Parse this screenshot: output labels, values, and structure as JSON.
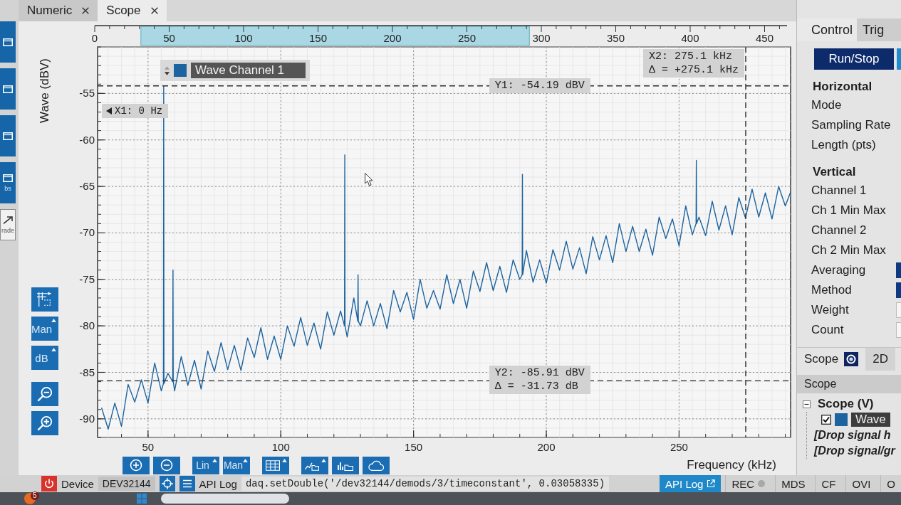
{
  "tabs": [
    {
      "label": "Numeric",
      "selected": false
    },
    {
      "label": "Scope",
      "selected": true
    }
  ],
  "side_strip": [
    {
      "kind": "tile"
    },
    {
      "kind": "tile"
    },
    {
      "kind": "tile"
    },
    {
      "kind": "tile",
      "label": "bs"
    },
    {
      "kind": "outlined",
      "label": "rade"
    }
  ],
  "scope": {
    "y_toolbar": {
      "range_mode": "Man",
      "scale": "dB"
    },
    "overview": {
      "tick_labels": [
        "0",
        "50",
        "100",
        "150",
        "200",
        "250",
        "300",
        "350",
        "400",
        "450"
      ]
    },
    "offscreen_cursor": {
      "label": "X1: 0 Hz"
    },
    "cursor_deltas": {
      "x": "Δ = +275.1 kHz",
      "y": "Δ = -31.73 dB"
    },
    "chart_data": {
      "type": "line",
      "xlabel": "Frequency (kHz)",
      "ylabel": "Wave (dBV)",
      "grid": true,
      "xlim": [
        31,
        292
      ],
      "ylim": [
        -92,
        -50
      ],
      "xticks": [
        50,
        100,
        150,
        200,
        250
      ],
      "yticks": [
        -90,
        -85,
        -80,
        -75,
        -70,
        -65,
        -60,
        -55
      ],
      "x": [
        32.5,
        35,
        37.5,
        40,
        42.5,
        45,
        47.5,
        50,
        52.5,
        55,
        55.8,
        55.9,
        56,
        57.5,
        59.3,
        59.4,
        59.5,
        60,
        62.5,
        65,
        67.5,
        70,
        72.5,
        75,
        77.5,
        80,
        82.5,
        85,
        87.5,
        90,
        92.5,
        95,
        97.5,
        100,
        102.5,
        105,
        107.5,
        110,
        112.5,
        115,
        117.5,
        120,
        122.5,
        124,
        124.1,
        124.2,
        125,
        127.5,
        129,
        129.1,
        129.2,
        130,
        132.5,
        135,
        137.5,
        140,
        142.5,
        145,
        147.5,
        150,
        152.5,
        155,
        157.5,
        160,
        162.5,
        165,
        167.5,
        170,
        172.5,
        175,
        177.5,
        180,
        182.5,
        185,
        187.5,
        190,
        190.9,
        191,
        191.1,
        192.5,
        195,
        197.5,
        200,
        202.5,
        205,
        207.5,
        210,
        212.5,
        215,
        217.5,
        220,
        222.5,
        225,
        227.5,
        230,
        232.5,
        235,
        237.5,
        240,
        242.5,
        245,
        247.5,
        250,
        252.5,
        255,
        256.4,
        256.5,
        256.6,
        257.5,
        260,
        262.5,
        265,
        267.5,
        270,
        272.5,
        275,
        277.5,
        280,
        282.5,
        285,
        287.5,
        290,
        292
      ],
      "series": [
        {
          "name": "Wave Channel 1",
          "color": "#1c64a0",
          "values": [
            -88.8,
            -91.1,
            -88.3,
            -90.8,
            -86.3,
            -88.2,
            -85.8,
            -88.3,
            -84.0,
            -87.0,
            -86.2,
            -54.19,
            -86.2,
            -85.1,
            -86.0,
            -74.0,
            -86.0,
            -87.0,
            -83.3,
            -86.4,
            -83.7,
            -86.8,
            -82.7,
            -84.9,
            -81.8,
            -84.7,
            -82.1,
            -84.8,
            -81.3,
            -83.4,
            -80.2,
            -83.6,
            -81.1,
            -83.6,
            -80.0,
            -82.2,
            -79.1,
            -82.1,
            -79.7,
            -82.5,
            -78.5,
            -81.0,
            -78.4,
            -80.0,
            -61.6,
            -80.0,
            -81.2,
            -77.0,
            -79.5,
            -74.5,
            -79.5,
            -80.0,
            -77.3,
            -80.0,
            -77.6,
            -80.3,
            -76.2,
            -78.5,
            -76.4,
            -79.3,
            -75.0,
            -78.1,
            -76.2,
            -78.2,
            -74.5,
            -77.6,
            -75.0,
            -78.1,
            -74.1,
            -76.3,
            -73.2,
            -76.2,
            -73.6,
            -76.4,
            -72.9,
            -75.0,
            -74.5,
            -63.7,
            -74.5,
            -71.9,
            -75.3,
            -72.9,
            -75.4,
            -71.8,
            -74.0,
            -70.9,
            -73.9,
            -71.6,
            -74.4,
            -70.4,
            -72.9,
            -70.3,
            -73.2,
            -69.0,
            -72.0,
            -69.3,
            -72.0,
            -69.6,
            -72.4,
            -68.3,
            -70.6,
            -68.5,
            -71.4,
            -67.1,
            -70.2,
            -69.0,
            -62.2,
            -69.0,
            -68.3,
            -70.3,
            -66.6,
            -69.7,
            -67.1,
            -70.2,
            -66.2,
            -68.4,
            -65.3,
            -68.3,
            -65.7,
            -68.5,
            -65.0,
            -67.1,
            -65.6
          ]
        }
      ],
      "ref_lines": [
        {
          "axis": "x",
          "value": 275.1,
          "label": "X2: 275.1 kHz"
        },
        {
          "axis": "y",
          "value": -54.19,
          "label": "Y1: -54.19 dBV"
        },
        {
          "axis": "y",
          "value": -85.91,
          "label": "Y2: -85.91 dBV"
        }
      ]
    },
    "x_toolbar": {
      "scale": "Lin",
      "range_mode": "Man"
    }
  },
  "control_panel": {
    "tabs": [
      {
        "label": "Control",
        "selected": true
      },
      {
        "label": "Trig",
        "selected": false
      }
    ],
    "run_button": "Run/Stop",
    "sections": [
      {
        "title": "Horizontal",
        "rows": [
          {
            "label": "Mode",
            "kind": "plain"
          },
          {
            "label": "Sampling Rate",
            "kind": "plain"
          },
          {
            "label": "Length (pts)",
            "kind": "plain"
          }
        ]
      },
      {
        "title": "Vertical",
        "rows": [
          {
            "label": "Channel 1",
            "kind": "plain"
          },
          {
            "label": "Ch 1 Min Max",
            "kind": "plain"
          },
          {
            "label": "Channel 2",
            "kind": "plain"
          },
          {
            "label": "Ch 2 Min Max",
            "kind": "plain"
          },
          {
            "label": "Averaging",
            "kind": "dropdown"
          },
          {
            "label": "Method",
            "kind": "dropdown"
          },
          {
            "label": "Weight",
            "kind": "field"
          },
          {
            "label": "Count",
            "kind": "field"
          }
        ]
      }
    ],
    "view_tabs": [
      {
        "label": "Scope",
        "selected": true
      },
      {
        "label": "2D",
        "selected": false
      }
    ],
    "tree": {
      "header": "Scope",
      "nodes": [
        {
          "label": "Scope (V)",
          "expanded": true,
          "children": [
            {
              "kind": "signal",
              "label": "Wave",
              "checked": true
            },
            {
              "kind": "drop",
              "label": "[Drop signal h"
            },
            {
              "kind": "drop",
              "label": "[Drop signal/gr"
            }
          ]
        }
      ]
    }
  },
  "status_bar": {
    "device_label": "Device",
    "device": "DEV32144",
    "log_label": "API Log",
    "log_text": "daq.setDouble('/dev32144/demods/3/timeconstant', 0.03058335)",
    "log_button": "API Log",
    "indicators": [
      {
        "label": "REC",
        "kind": "dot",
        "on": false
      },
      {
        "label": "MDS",
        "kind": "plain",
        "on": false
      },
      {
        "label": "CF",
        "kind": "plain",
        "on": false
      },
      {
        "label": "OVI",
        "kind": "plain",
        "on": false
      },
      {
        "label": "O",
        "kind": "plain",
        "on": false
      }
    ]
  },
  "taskbar": {
    "badge": "5"
  }
}
